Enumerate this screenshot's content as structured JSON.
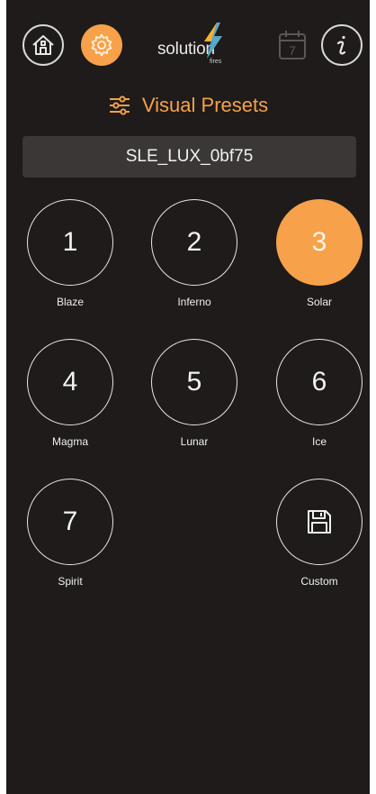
{
  "header": {
    "logo_text": "solution",
    "logo_sub": "fires",
    "icons": {
      "home": "home-icon",
      "settings": "gear-icon",
      "calendar": "calendar-icon",
      "info": "info-icon"
    },
    "calendar_day": "7"
  },
  "section": {
    "title": "Visual Presets",
    "icon": "sliders-icon"
  },
  "device": {
    "name": "SLE_LUX_0bf75"
  },
  "presets": [
    {
      "number": "1",
      "label": "Blaze",
      "active": false
    },
    {
      "number": "2",
      "label": "Inferno",
      "active": false
    },
    {
      "number": "3",
      "label": "Solar",
      "active": true
    },
    {
      "number": "4",
      "label": "Magma",
      "active": false
    },
    {
      "number": "5",
      "label": "Lunar",
      "active": false
    },
    {
      "number": "6",
      "label": "Ice",
      "active": false
    },
    {
      "number": "7",
      "label": "Spirit",
      "active": false
    }
  ],
  "custom": {
    "label": "Custom",
    "icon": "save-icon"
  },
  "colors": {
    "accent": "#f7a14a",
    "background": "#1e1b1a",
    "field": "#3a3736"
  }
}
